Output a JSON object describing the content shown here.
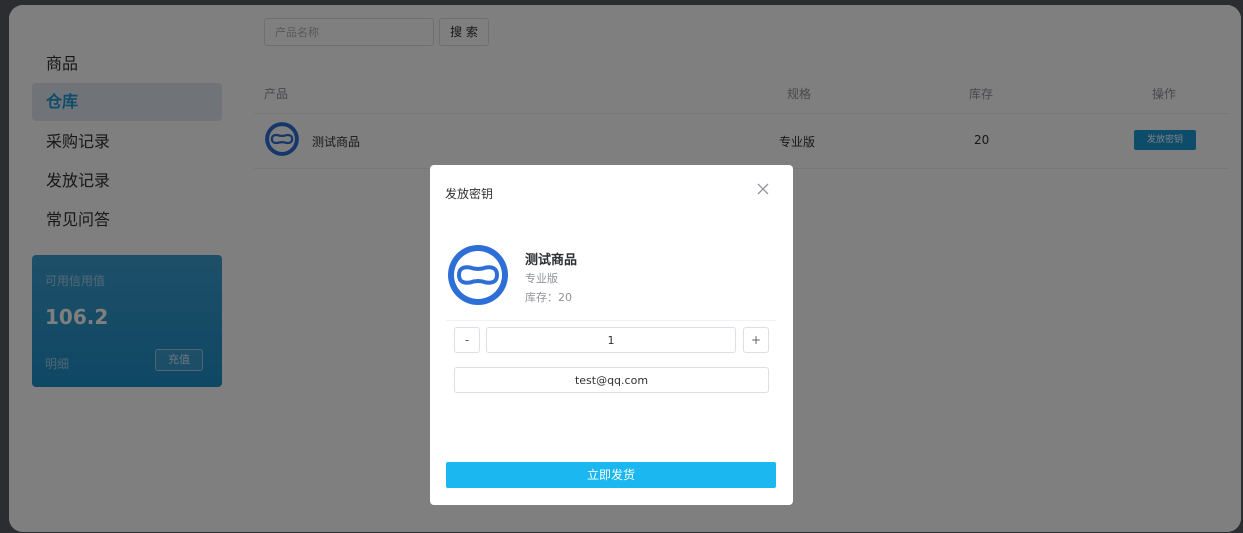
{
  "sidebar": {
    "items": [
      {
        "label": "商品",
        "active": false
      },
      {
        "label": "仓库",
        "active": true
      },
      {
        "label": "采购记录",
        "active": false
      },
      {
        "label": "发放记录",
        "active": false
      },
      {
        "label": "常见问答",
        "active": false
      }
    ],
    "credit": {
      "title": "可用信用值",
      "value": "106.2",
      "detail_label": "明细",
      "recharge_label": "充值"
    }
  },
  "search": {
    "placeholder": "产品名称",
    "button_label": "搜 索"
  },
  "table": {
    "headers": {
      "product": "产品",
      "spec": "规格",
      "stock": "库存",
      "action": "操作"
    },
    "rows": [
      {
        "product": "测试商品",
        "spec": "专业版",
        "stock": "20",
        "action_label": "发放密钥"
      }
    ]
  },
  "modal": {
    "title": "发放密钥",
    "product_name": "测试商品",
    "product_spec": "专业版",
    "product_stock": "库存：20",
    "decrement_label": "-",
    "increment_label": "+",
    "quantity": "1",
    "email": "test@qq.com",
    "submit_label": "立即发货"
  },
  "icons": {
    "product_logo": "vr-headset-logo",
    "close": "close-icon"
  },
  "colors": {
    "accent": "#1b9ad6",
    "submit": "#1ab7f0",
    "logo_blue": "#2d6fd6"
  }
}
